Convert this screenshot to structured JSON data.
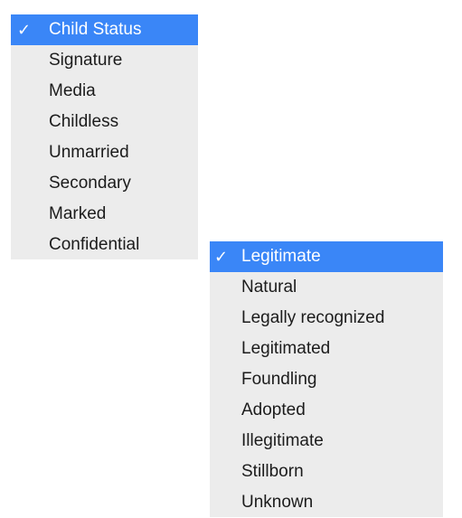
{
  "menus": {
    "category": {
      "check_glyph": "✓",
      "items": [
        {
          "label": "Child Status",
          "selected": true
        },
        {
          "label": "Signature",
          "selected": false
        },
        {
          "label": "Media",
          "selected": false
        },
        {
          "label": "Childless",
          "selected": false
        },
        {
          "label": "Unmarried",
          "selected": false
        },
        {
          "label": "Secondary",
          "selected": false
        },
        {
          "label": "Marked",
          "selected": false
        },
        {
          "label": "Confidential",
          "selected": false
        }
      ]
    },
    "child_status": {
      "check_glyph": "✓",
      "items": [
        {
          "label": "Legitimate",
          "selected": true
        },
        {
          "label": "Natural",
          "selected": false
        },
        {
          "label": "Legally recognized",
          "selected": false
        },
        {
          "label": "Legitimated",
          "selected": false
        },
        {
          "label": "Foundling",
          "selected": false
        },
        {
          "label": "Adopted",
          "selected": false
        },
        {
          "label": "Illegitimate",
          "selected": false
        },
        {
          "label": "Stillborn",
          "selected": false
        },
        {
          "label": "Unknown",
          "selected": false
        }
      ]
    }
  },
  "colors": {
    "menu_background": "#ececec",
    "selection": "#3a86f7",
    "text": "#1c1c1c",
    "selected_text": "#ffffff"
  }
}
